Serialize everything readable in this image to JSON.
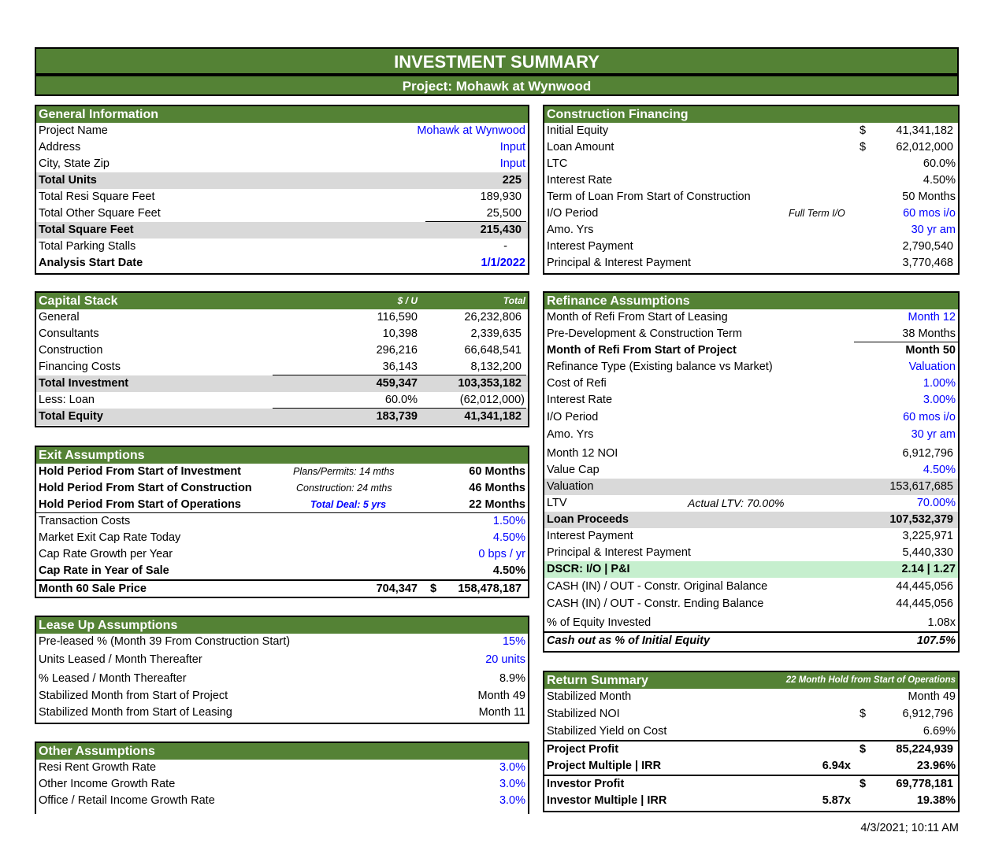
{
  "title": "INVESTMENT SUMMARY",
  "subtitle": "Project: Mohawk at Wynwood",
  "timestamp": "4/3/2021; 10:11 AM",
  "general": {
    "title": "General Information",
    "rows": [
      {
        "label": "Project Name",
        "value": "Mohawk at Wynwood"
      },
      {
        "label": "Address",
        "value": "Input"
      },
      {
        "label": "City, State Zip",
        "value": "Input"
      },
      {
        "label": "Total Units",
        "value": "225"
      },
      {
        "label": "Total Resi Square Feet",
        "value": "189,930"
      },
      {
        "label": "Total Other Square Feet",
        "value": "25,500"
      },
      {
        "label": "Total Square Feet",
        "value": "215,430"
      },
      {
        "label": "Total Parking Stalls",
        "value": "-"
      },
      {
        "label": "Analysis Start Date",
        "value": "1/1/2022"
      }
    ]
  },
  "capital": {
    "title": "Capital Stack",
    "col1": "$ / U",
    "col2": "Total",
    "rows": [
      {
        "label": "General",
        "v1": "116,590",
        "v2": "26,232,806"
      },
      {
        "label": "Consultants",
        "v1": "10,398",
        "v2": "2,339,635"
      },
      {
        "label": "Construction",
        "v1": "296,216",
        "v2": "66,648,541"
      },
      {
        "label": "Financing Costs",
        "v1": "36,143",
        "v2": "8,132,200"
      },
      {
        "label": "Total Investment",
        "v1": "459,347",
        "v2": "103,353,182"
      },
      {
        "label": "Less: Loan",
        "v1": "60.0%",
        "v2": "(62,012,000)"
      },
      {
        "label": "Total Equity",
        "v1": "183,739",
        "v2": "41,341,182"
      }
    ]
  },
  "exit": {
    "title": "Exit Assumptions",
    "rows": [
      {
        "label": "Hold Period From Start of Investment",
        "note": "Plans/Permits: 14 mths",
        "value": "60 Months"
      },
      {
        "label": "Hold Period From Start of Construction",
        "note": "Construction: 24 mths",
        "value": "46 Months"
      },
      {
        "label": "Hold Period From Start of Operations",
        "note": "Total Deal: 5 yrs",
        "value": "22 Months"
      },
      {
        "label": "Transaction Costs",
        "value": "1.50%"
      },
      {
        "label": "Market Exit Cap Rate Today",
        "value": "4.50%"
      },
      {
        "label": "Cap Rate Growth per Year",
        "value": "0 bps / yr"
      },
      {
        "label": "Cap Rate in Year of Sale",
        "value": "4.50%"
      },
      {
        "label": "Month 60 Sale Price",
        "v1": "704,347",
        "cur": "$",
        "value": "158,478,187"
      }
    ]
  },
  "lease": {
    "title": "Lease Up Assumptions",
    "rows": [
      {
        "label": "Pre-leased % (Month 39 From Construction Start)",
        "value": "15%"
      },
      {
        "label": "Units Leased / Month Thereafter",
        "value": "20 units"
      },
      {
        "label": "% Leased / Month Thereafter",
        "value": "8.9%"
      },
      {
        "label": "Stabilized Month from Start of Project",
        "value": "Month 49"
      },
      {
        "label": "Stabilized Month from Start of Leasing",
        "value": "Month 11"
      }
    ]
  },
  "other": {
    "title": "Other Assumptions",
    "rows": [
      {
        "label": "Resi Rent Growth Rate",
        "value": "3.0%"
      },
      {
        "label": "Other Income Growth Rate",
        "value": "3.0%"
      },
      {
        "label": "Office / Retail Income Growth Rate",
        "value": "3.0%"
      }
    ]
  },
  "construction": {
    "title": "Construction Financing",
    "rows": [
      {
        "label": "Initial Equity",
        "cur": "$",
        "value": "41,341,182"
      },
      {
        "label": "Loan Amount",
        "cur": "$",
        "value": "62,012,000"
      },
      {
        "label": "LTC",
        "value": "60.0%"
      },
      {
        "label": "Interest Rate",
        "value": "4.50%"
      },
      {
        "label": "Term of Loan From Start of Construction",
        "value": "50 Months"
      },
      {
        "label": "I/O Period",
        "note": "Full Term I/O",
        "value": "60 mos i/o"
      },
      {
        "label": "Amo. Yrs",
        "value": "30 yr am"
      },
      {
        "label": "Interest Payment",
        "value": "2,790,540"
      },
      {
        "label": "Principal & Interest Payment",
        "value": "3,770,468"
      }
    ]
  },
  "refi": {
    "title": "Refinance Assumptions",
    "rows": [
      {
        "label": "Month of Refi From Start of Leasing",
        "value": "Month 12"
      },
      {
        "label": "Pre-Development & Construction Term",
        "value": "38 Months"
      },
      {
        "label": "Month of Refi From Start of Project",
        "value": "Month 50"
      },
      {
        "label": "Refinance Type (Existing balance vs Market)",
        "value": "Valuation"
      },
      {
        "label": "Cost of Refi",
        "value": "1.00%"
      },
      {
        "label": "Interest Rate",
        "value": "3.00%"
      },
      {
        "label": "I/O Period",
        "value": "60 mos i/o"
      },
      {
        "label": "Amo. Yrs",
        "value": "30 yr am"
      },
      {
        "label": "Month 12 NOI",
        "value": "6,912,796"
      },
      {
        "label": "Value Cap",
        "value": "4.50%"
      },
      {
        "label": "Valuation",
        "value": "153,617,685"
      },
      {
        "label": "LTV",
        "note": "Actual LTV:  70.00%",
        "value": "70.00%"
      },
      {
        "label": "Loan Proceeds",
        "value": "107,532,379"
      },
      {
        "label": "Interest Payment",
        "value": "3,225,971"
      },
      {
        "label": "Principal & Interest Payment",
        "value": "5,440,330"
      },
      {
        "label": "DSCR: I/O | P&I",
        "value": "2.14 | 1.27"
      },
      {
        "label": "CASH (IN) / OUT - Constr. Original Balance",
        "value": "44,445,056"
      },
      {
        "label": "CASH (IN) / OUT - Constr. Ending Balance",
        "value": "44,445,056"
      },
      {
        "label": "% of Equity Invested",
        "value": "1.08x"
      },
      {
        "label": "Cash out as % of Initial Equity",
        "value": "107.5%"
      }
    ]
  },
  "returns": {
    "title": "Return Summary",
    "header_note": "22 Month Hold from Start of Operations",
    "rows": [
      {
        "label": "Stabilized Month",
        "value": "Month 49"
      },
      {
        "label": "Stabilized NOI",
        "cur": "$",
        "value": "6,912,796"
      },
      {
        "label": "Stabilized Yield on Cost",
        "value": "6.69%"
      },
      {
        "label": "Project Profit",
        "cur": "$",
        "value": "85,224,939"
      },
      {
        "label": "Project Multiple | IRR",
        "mult": "6.94x",
        "value": "23.96%"
      },
      {
        "label": "Investor Profit",
        "cur": "$",
        "value": "69,778,181"
      },
      {
        "label": "Investor Multiple | IRR",
        "mult": "5.87x",
        "value": "19.38%"
      }
    ]
  },
  "colors": {
    "header_green": "#548235",
    "input_blue": "#0000ff",
    "total_gray": "#d9d9d9",
    "dscr_green": "#c6efce"
  }
}
